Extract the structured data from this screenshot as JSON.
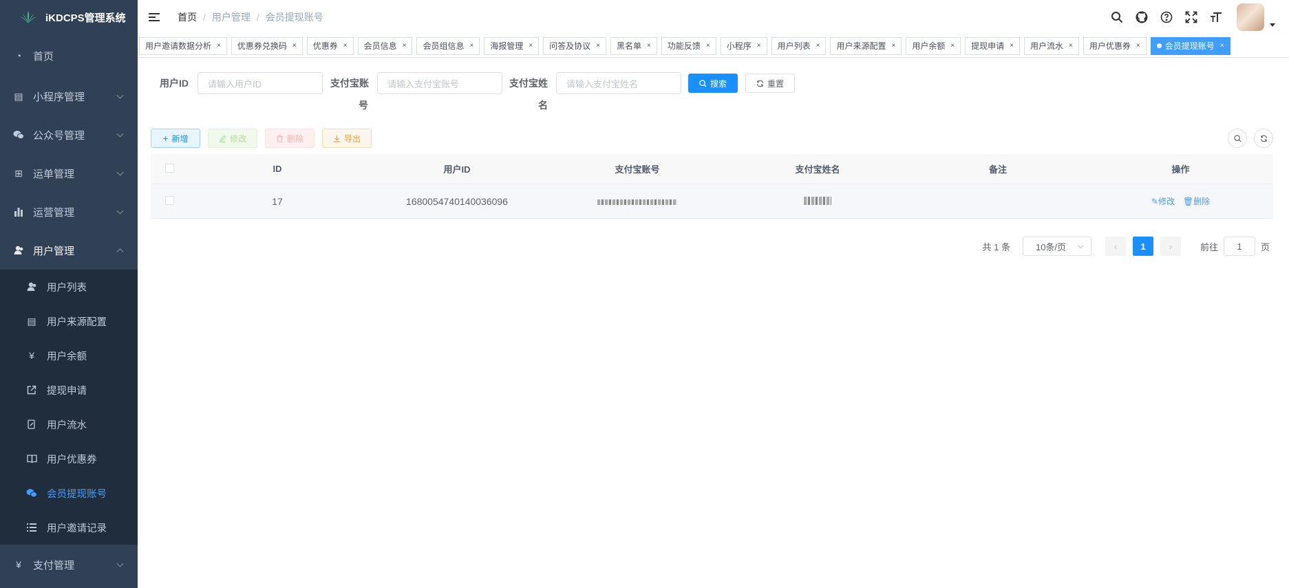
{
  "app": {
    "title": "iKDCPS管理系统"
  },
  "colors": {
    "sidebar_bg": "#304156",
    "submenu_bg": "#1f2d3d",
    "accent": "#409eff",
    "primary_button": "#1890ff"
  },
  "sidebar": {
    "items": [
      {
        "label": "首页",
        "icon": "dashboard-icon"
      },
      {
        "label": "小程序管理",
        "icon": "document-icon"
      },
      {
        "label": "公众号管理",
        "icon": "wechat-icon"
      },
      {
        "label": "运单管理",
        "icon": "table-icon"
      },
      {
        "label": "运营管理",
        "icon": "bar-chart-icon"
      },
      {
        "label": "用户管理",
        "icon": "user-icon"
      },
      {
        "label": "支付管理",
        "icon": "yen-icon"
      }
    ],
    "sub_items": [
      {
        "label": "用户列表",
        "icon": "users-icon"
      },
      {
        "label": "用户来源配置",
        "icon": "document-icon"
      },
      {
        "label": "用户余额",
        "icon": "yen-icon"
      },
      {
        "label": "提现申请",
        "icon": "external-link-icon"
      },
      {
        "label": "用户流水",
        "icon": "edit-document-icon"
      },
      {
        "label": "用户优惠券",
        "icon": "book-icon"
      },
      {
        "label": "会员提现账号",
        "icon": "wechat-icon"
      },
      {
        "label": "用户邀请记录",
        "icon": "list-icon"
      }
    ]
  },
  "breadcrumb": {
    "home": "首页",
    "parent": "用户管理",
    "current": "会员提现账号",
    "separator": "/"
  },
  "tags": [
    "用户邀请数据分析",
    "优惠券兑换码",
    "优惠券",
    "会员信息",
    "会员组信息",
    "海报管理",
    "问答及协议",
    "黑名单",
    "功能反馈",
    "小程序",
    "用户列表",
    "用户来源配置",
    "用户余额",
    "提现申请",
    "用户流水",
    "用户优惠券",
    "会员提现账号"
  ],
  "tag_close": "×",
  "search": {
    "user_id_label": "用户ID",
    "user_id_placeholder": "请输入用户ID",
    "alipay_account_label_1": "支付宝账",
    "alipay_account_label_2": "号",
    "alipay_account_placeholder": "请输入支付宝账号",
    "alipay_name_label_1": "支付宝姓",
    "alipay_name_label_2": "名",
    "alipay_name_placeholder": "请输入支付宝姓名",
    "search_button": "搜索",
    "reset_button": "重置"
  },
  "toolbar": {
    "add": "新增",
    "edit": "修改",
    "delete": "删除",
    "export": "导出"
  },
  "table": {
    "columns": [
      "ID",
      "用户ID",
      "支付宝账号",
      "支付宝姓名",
      "备注",
      "操作"
    ],
    "rows": [
      {
        "id": "17",
        "user_id": "1680054740140036096",
        "remark": "",
        "edit": "修改",
        "delete": "删除"
      }
    ]
  },
  "pagination": {
    "total": "共 1 条",
    "page_size": "10条/页",
    "current_page": "1",
    "goto_label": "前往",
    "goto_value": "1",
    "page_suffix": "页",
    "prev": "‹",
    "next": "›"
  }
}
